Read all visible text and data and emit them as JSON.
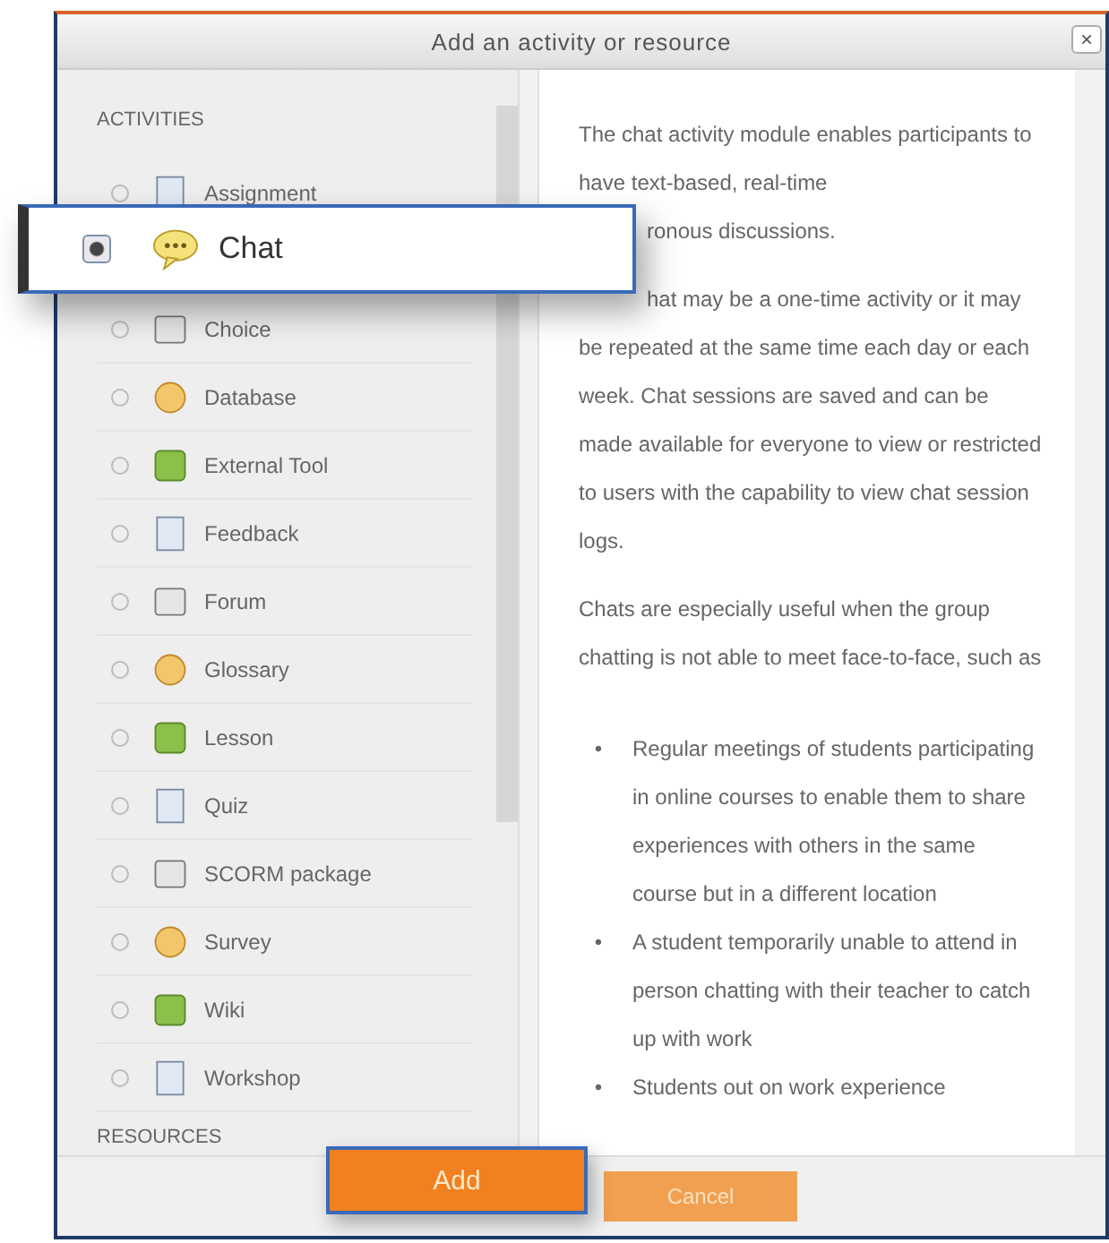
{
  "dialog": {
    "title": "Add an activity or resource",
    "close": "×"
  },
  "activities": {
    "heading": "ACTIVITIES",
    "items": [
      {
        "label": "Assignment",
        "selected": false
      },
      {
        "label": "Choice",
        "selected": false
      },
      {
        "label": "Database",
        "selected": false
      },
      {
        "label": "External Tool",
        "selected": false
      },
      {
        "label": "Feedback",
        "selected": false
      },
      {
        "label": "Forum",
        "selected": false
      },
      {
        "label": "Glossary",
        "selected": false
      },
      {
        "label": "Lesson",
        "selected": false
      },
      {
        "label": "Quiz",
        "selected": false
      },
      {
        "label": "SCORM package",
        "selected": false
      },
      {
        "label": "Survey",
        "selected": false
      },
      {
        "label": "Wiki",
        "selected": false
      },
      {
        "label": "Workshop",
        "selected": false
      }
    ]
  },
  "resources": {
    "heading": "RESOURCES"
  },
  "description": {
    "paragraphs": [
      {
        "kind": "text",
        "text": "The chat activity module enables participants to have text-based, real-time"
      },
      {
        "kind": "covered_start",
        "text": "ronous discussions."
      },
      {
        "kind": "covered_start",
        "text": "hat may be a one-time activity or it may be repeated at the same time each day or each week. Chat sessions are saved and can be made available for everyone to view or restricted to users with the capability to view chat session logs."
      },
      {
        "kind": "text",
        "text": "Chats are especially useful when the group chatting is not able to meet face-to-face, such as"
      }
    ],
    "bullets": [
      {
        "marker": "•",
        "text": "Regular meetings of students participating in online courses to enable them to share experiences with others in the same course but in a different location"
      },
      {
        "marker": "•",
        "text": "A student temporarily unable to attend in person chatting with their teacher to catch up with work"
      },
      {
        "marker": "•",
        "text": "Students out on work experience"
      }
    ]
  },
  "footer": {
    "cancel": "Cancel"
  },
  "callout": {
    "item": {
      "label": "Chat",
      "selected": true
    },
    "button": "Add"
  }
}
